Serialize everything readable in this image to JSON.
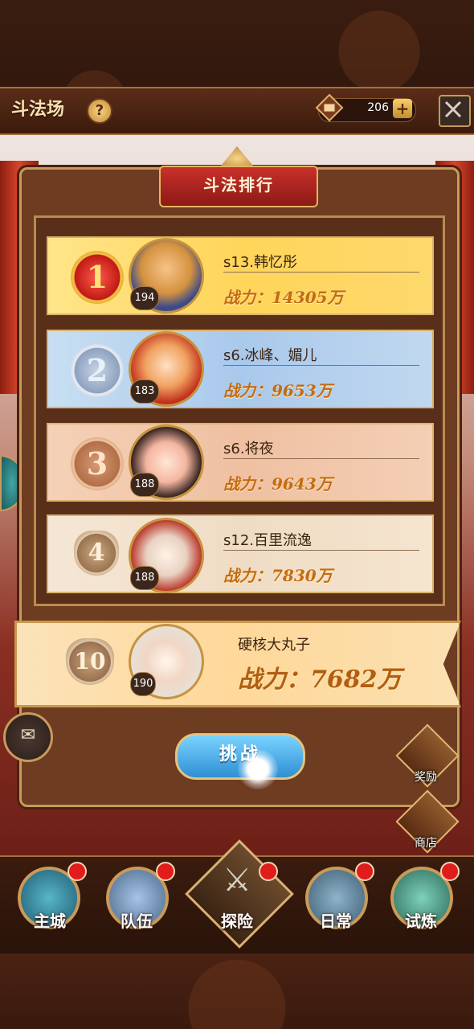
{
  "header": {
    "title": "斗法场",
    "help_label": "?",
    "currency_value": "206",
    "plus_label": "+"
  },
  "banner": {
    "title": "斗法排行"
  },
  "rankings": [
    {
      "rank": "1",
      "name": "s13.韩忆彤",
      "power": "战力：14305万",
      "level": "194"
    },
    {
      "rank": "2",
      "name": "s6.冰峰、媚儿",
      "power": "战力：9653万",
      "level": "183"
    },
    {
      "rank": "3",
      "name": "s6.将夜",
      "power": "战力：9643万",
      "level": "188"
    },
    {
      "rank": "4",
      "name": "s12.百里流逸",
      "power": "战力：7830万",
      "level": "188"
    }
  ],
  "self": {
    "rank": "10",
    "name": "硬核大丸子",
    "power": "战力：7682万",
    "level": "190"
  },
  "challenge_label": "挑战",
  "side_buttons": {
    "reward": "奖励",
    "shop": "商店"
  },
  "nav": [
    {
      "label": "主城"
    },
    {
      "label": "队伍"
    },
    {
      "label": "探险"
    },
    {
      "label": "日常"
    },
    {
      "label": "试炼"
    }
  ]
}
